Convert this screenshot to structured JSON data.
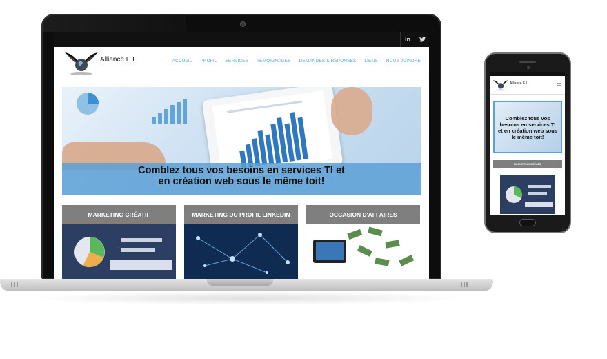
{
  "site": {
    "brand": "Alliance E.L.",
    "social": [
      "in",
      "t"
    ],
    "menu": [
      "ACCUEIL",
      "PROFIL",
      "SERVICES",
      "TÉMOIGNAGES",
      "DEMANDES & RÉPONSES",
      "LIENS",
      "NOUS JOINDRE"
    ],
    "hero_line1": "Comblez tous vos besoins en services TI et",
    "hero_line2": "en création web sous le même toit!",
    "cards": [
      {
        "title": "MARKETING CRÉATIF"
      },
      {
        "title": "MARKETING DU PROFIL LINKEDIN"
      },
      {
        "title": "OCCASION D'AFFAIRES"
      }
    ]
  },
  "mobile": {
    "brand": "Alliance E.L.",
    "hero_text": "Comblez tous vos besoins en services TI et en création web sous le même toit!",
    "card_title": "MARKETING CRÉATIF"
  },
  "icons": {
    "linkedin": "linkedin-icon",
    "twitter": "twitter-icon",
    "logo": "eagle-globe-logo",
    "menu": "hamburger-icon"
  },
  "colors": {
    "accent": "#5aa9d6",
    "banner": "#5ca0d6",
    "card_header": "#7f7f7f",
    "topbar": "#111111"
  }
}
